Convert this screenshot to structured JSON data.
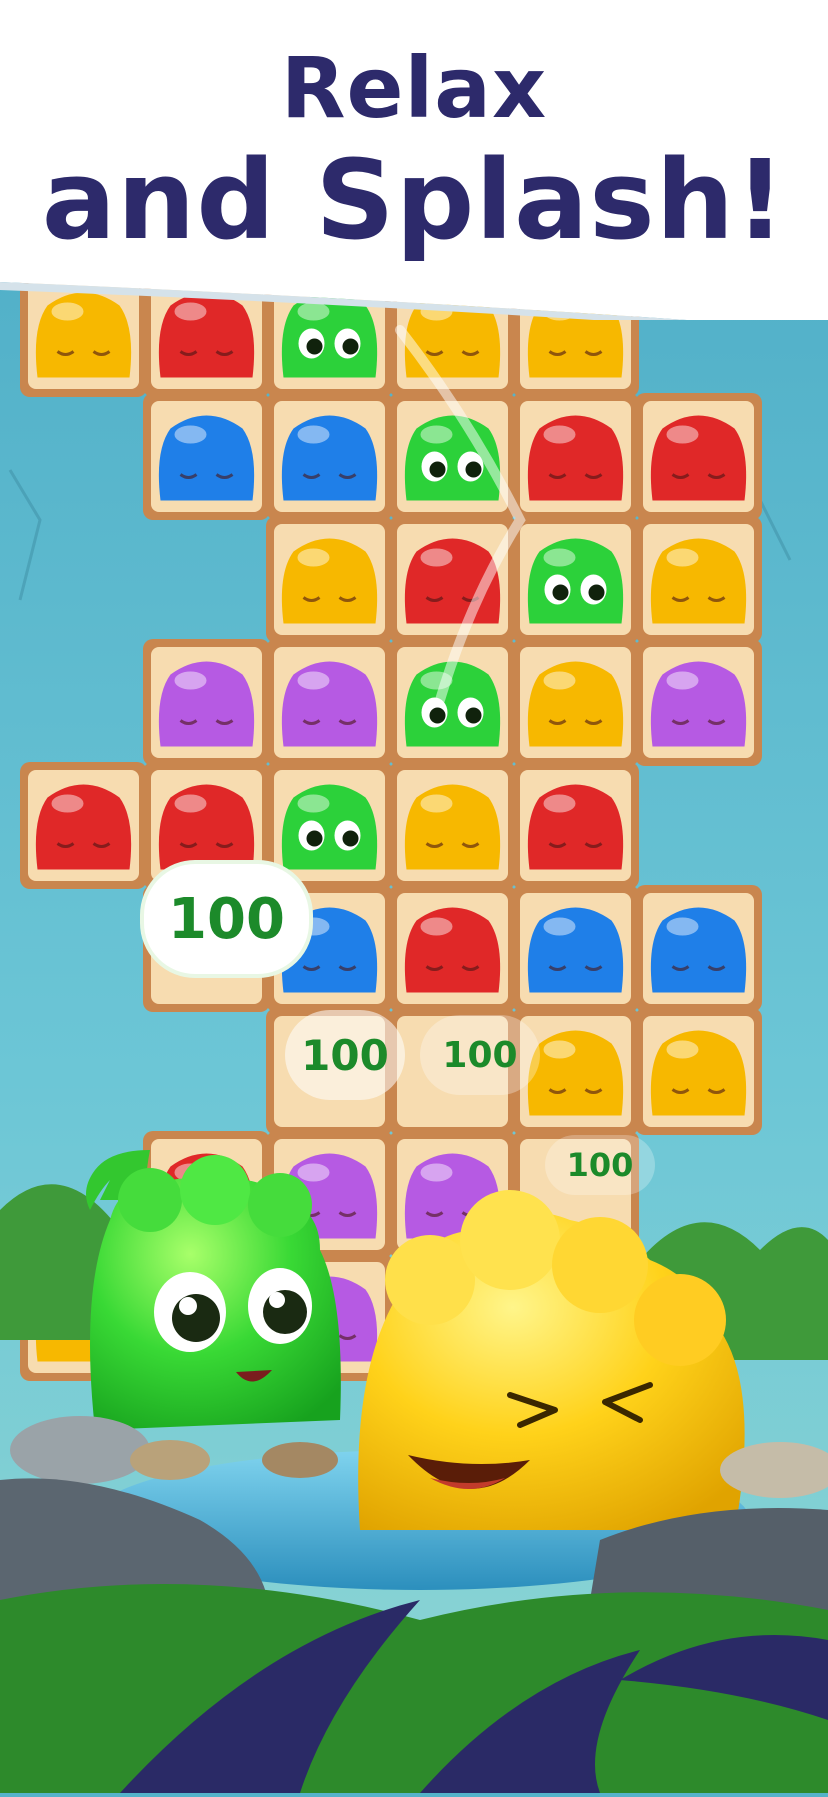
{
  "banner": {
    "line1": "Relax",
    "line2": "and Splash!"
  },
  "board": {
    "columns": 6,
    "rows": [
      [
        "yellow",
        "red",
        "green-face",
        "yellow",
        "yellow",
        null
      ],
      [
        null,
        "blue",
        "blue",
        "green-face",
        "red",
        "red"
      ],
      [
        null,
        null,
        "yellow",
        "red",
        "green-face",
        "yellow"
      ],
      [
        null,
        "purple",
        "purple",
        "green-face",
        "yellow",
        "purple"
      ],
      [
        "red",
        "red",
        "green-face",
        "yellow",
        "red",
        null
      ],
      [
        null,
        "score",
        "blue",
        "red",
        "blue",
        "blue"
      ],
      [
        null,
        null,
        "score",
        "score",
        "yellow",
        "yellow"
      ],
      [
        null,
        "red",
        "purple",
        "purple",
        "score",
        null
      ],
      [
        "yellow",
        null,
        "purple",
        null,
        null,
        null
      ]
    ]
  },
  "score_popups": [
    {
      "text": "100"
    },
    {
      "text": "100"
    },
    {
      "text": "100"
    },
    {
      "text": "100"
    }
  ],
  "colors": {
    "title": "#2d2a6b",
    "red": "#e02828",
    "blue": "#1f7fe8",
    "yellow": "#f7b800",
    "purple": "#b65ae3",
    "green": "#2cd13a",
    "tile": "#f7dcb0",
    "water": "#4fb4d8",
    "foliage": "#2e8a2c"
  }
}
